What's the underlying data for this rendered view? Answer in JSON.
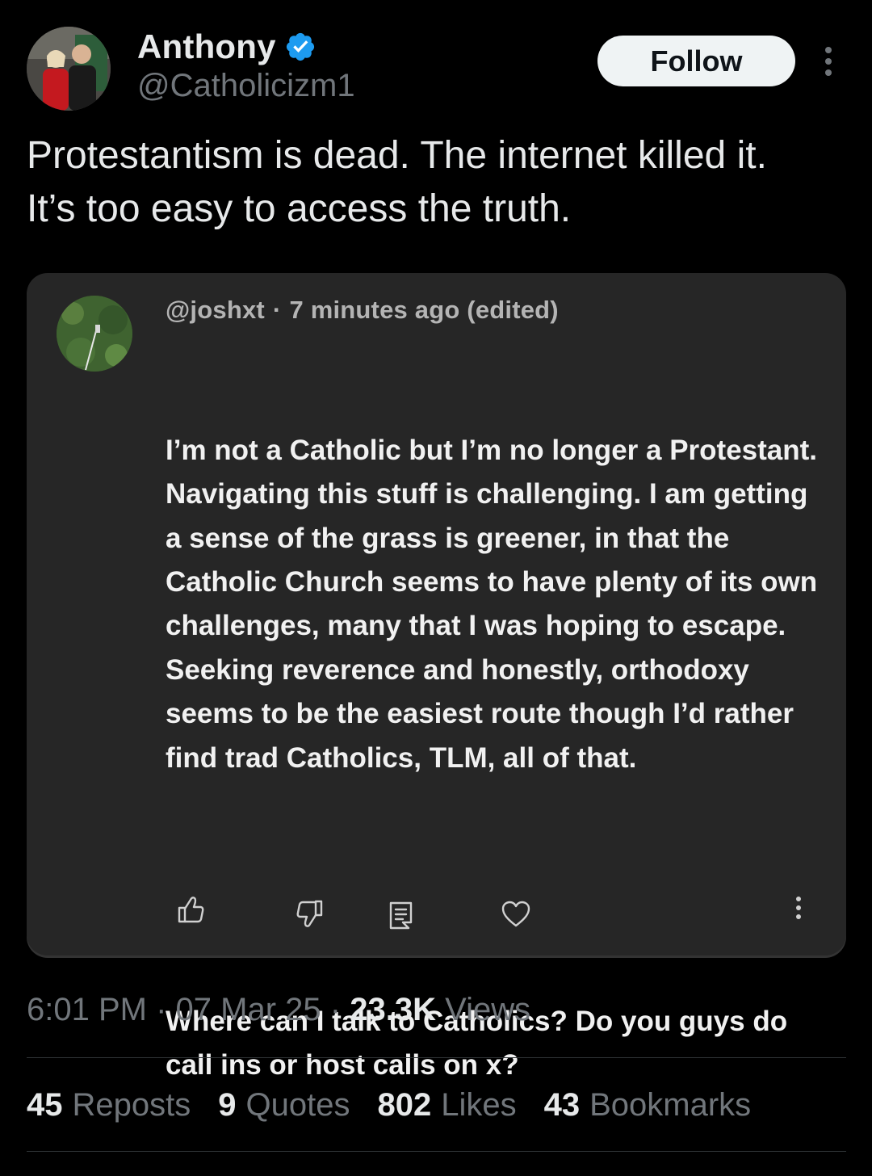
{
  "author": {
    "display_name": "Anthony",
    "handle": "@Catholicizm1",
    "verified_icon": "verified-badge-icon",
    "verified_color": "#1d9bf0"
  },
  "header": {
    "follow_label": "Follow",
    "more_icon": "more-vertical-icon"
  },
  "tweet": {
    "text": "Protestantism is dead. The internet killed it.\nIt’s too easy to access the truth."
  },
  "quoted_comment": {
    "handle": "@joshxt",
    "separator": "·",
    "time": "7 minutes ago (edited)",
    "paragraph_1": "I’m not a Catholic but I’m no longer a Protestant. Navigating this stuff is challenging. I am getting a sense of the grass is greener, in that the Catholic Church seems to have plenty of its own challenges, many that I was hoping to escape. Seeking reverence and honestly, orthodoxy seems to be the easiest route though I’d rather find trad Catholics, TLM, all of that.",
    "paragraph_2": "Where can I talk to Catholics? Do you guys do call ins or host calls on x?",
    "actions": [
      "thumbs-up-icon",
      "thumbs-down-icon",
      "comment-icon",
      "heart-icon",
      "more-vertical-icon"
    ]
  },
  "meta": {
    "time": "6:01 PM",
    "date": "07 Mar 25",
    "separator": "·",
    "views_count": "23.3K",
    "views_label": "Views"
  },
  "stats": {
    "reposts_count": "45",
    "reposts_label": "Reposts",
    "quotes_count": "9",
    "quotes_label": "Quotes",
    "likes_count": "802",
    "likes_label": "Likes",
    "bookmarks_count": "43",
    "bookmarks_label": "Bookmarks"
  }
}
